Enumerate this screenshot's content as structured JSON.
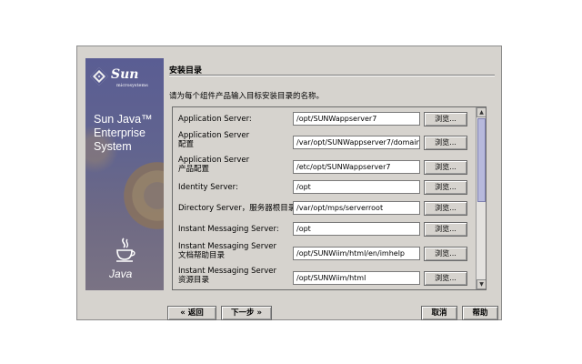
{
  "brand": {
    "logo_text": "Sun",
    "logo_sub": "microsystems",
    "title_lines": [
      "Sun Java™",
      "Enterprise",
      "System"
    ],
    "java_word": "Java"
  },
  "page": {
    "heading": "安装目录",
    "instruction": "请为每个组件产品输入目标安装目录的名称。"
  },
  "rows": [
    {
      "label_lines": [
        "Application Server:"
      ],
      "path": "/opt/SUNWappserver7",
      "browse": "浏览..."
    },
    {
      "label_lines": [
        "Application Server",
        "配置"
      ],
      "path": "/var/opt/SUNWappserver7/domains",
      "browse": "浏览..."
    },
    {
      "label_lines": [
        "Application Server",
        "产品配置"
      ],
      "path": "/etc/opt/SUNWappserver7",
      "browse": "浏览..."
    },
    {
      "label_lines": [
        "Identity Server:"
      ],
      "path": "/opt",
      "browse": "浏览..."
    },
    {
      "label_lines": [
        "Directory Server，服务器根目录:"
      ],
      "path": "/var/opt/mps/serverroot",
      "browse": "浏览..."
    },
    {
      "label_lines": [
        "Instant Messaging Server:"
      ],
      "path": "/opt",
      "browse": "浏览..."
    },
    {
      "label_lines": [
        "Instant Messaging Server",
        "文档帮助目录"
      ],
      "path": "/opt/SUNWiim/html/en/imhelp",
      "browse": "浏览..."
    },
    {
      "label_lines": [
        "Instant Messaging Server",
        "资源目录"
      ],
      "path": "/opt/SUNWiim/html",
      "browse": "浏览..."
    }
  ],
  "buttons": {
    "back": "« 返回",
    "next": "下一步 »",
    "cancel": "取消",
    "help": "帮助"
  },
  "colors": {
    "window_bg": "#d6d3ce",
    "brand_panel": "#5a5d93",
    "scroll_thumb": "#b7b9dc"
  }
}
